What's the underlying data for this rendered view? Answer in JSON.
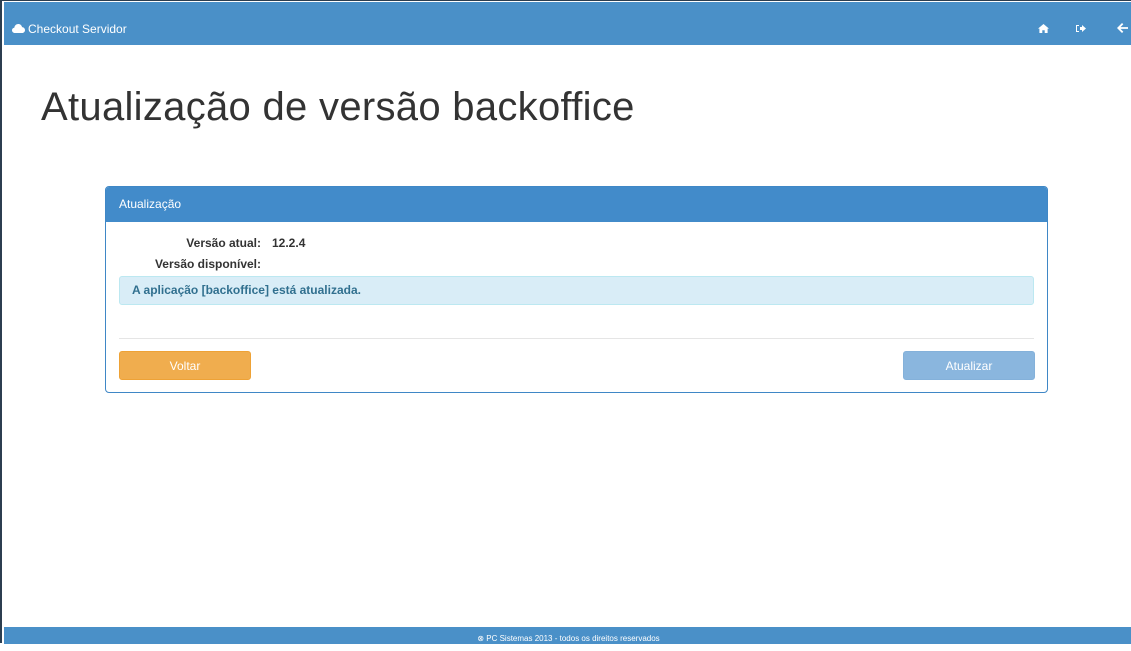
{
  "navbar": {
    "brand_label": "Checkout Servidor",
    "brand_icon": "cloud-icon",
    "actions": [
      {
        "name": "home-icon"
      },
      {
        "name": "logout-icon"
      },
      {
        "name": "back-arrow-icon"
      }
    ]
  },
  "page": {
    "title": "Atualização de versão backoffice"
  },
  "panel": {
    "heading": "Atualização",
    "current_version_label": "Versão atual:",
    "current_version_value": "12.2.4",
    "available_version_label": "Versão disponível:",
    "available_version_value": "",
    "alert_text": "A aplicação [backoffice] está atualizada.",
    "back_button_label": "Voltar",
    "update_button_label": "Atualizar"
  },
  "footer": {
    "text": "⊗ PC Sistemas 2013 - todos os direitos reservados"
  },
  "colors": {
    "navbar": "#4a90c8",
    "panel_heading": "#428bca",
    "warning_button": "#f0ad4e",
    "disabled_primary_button": "#8ab6de",
    "alert_background": "#d9edf7",
    "alert_text": "#31708f"
  }
}
